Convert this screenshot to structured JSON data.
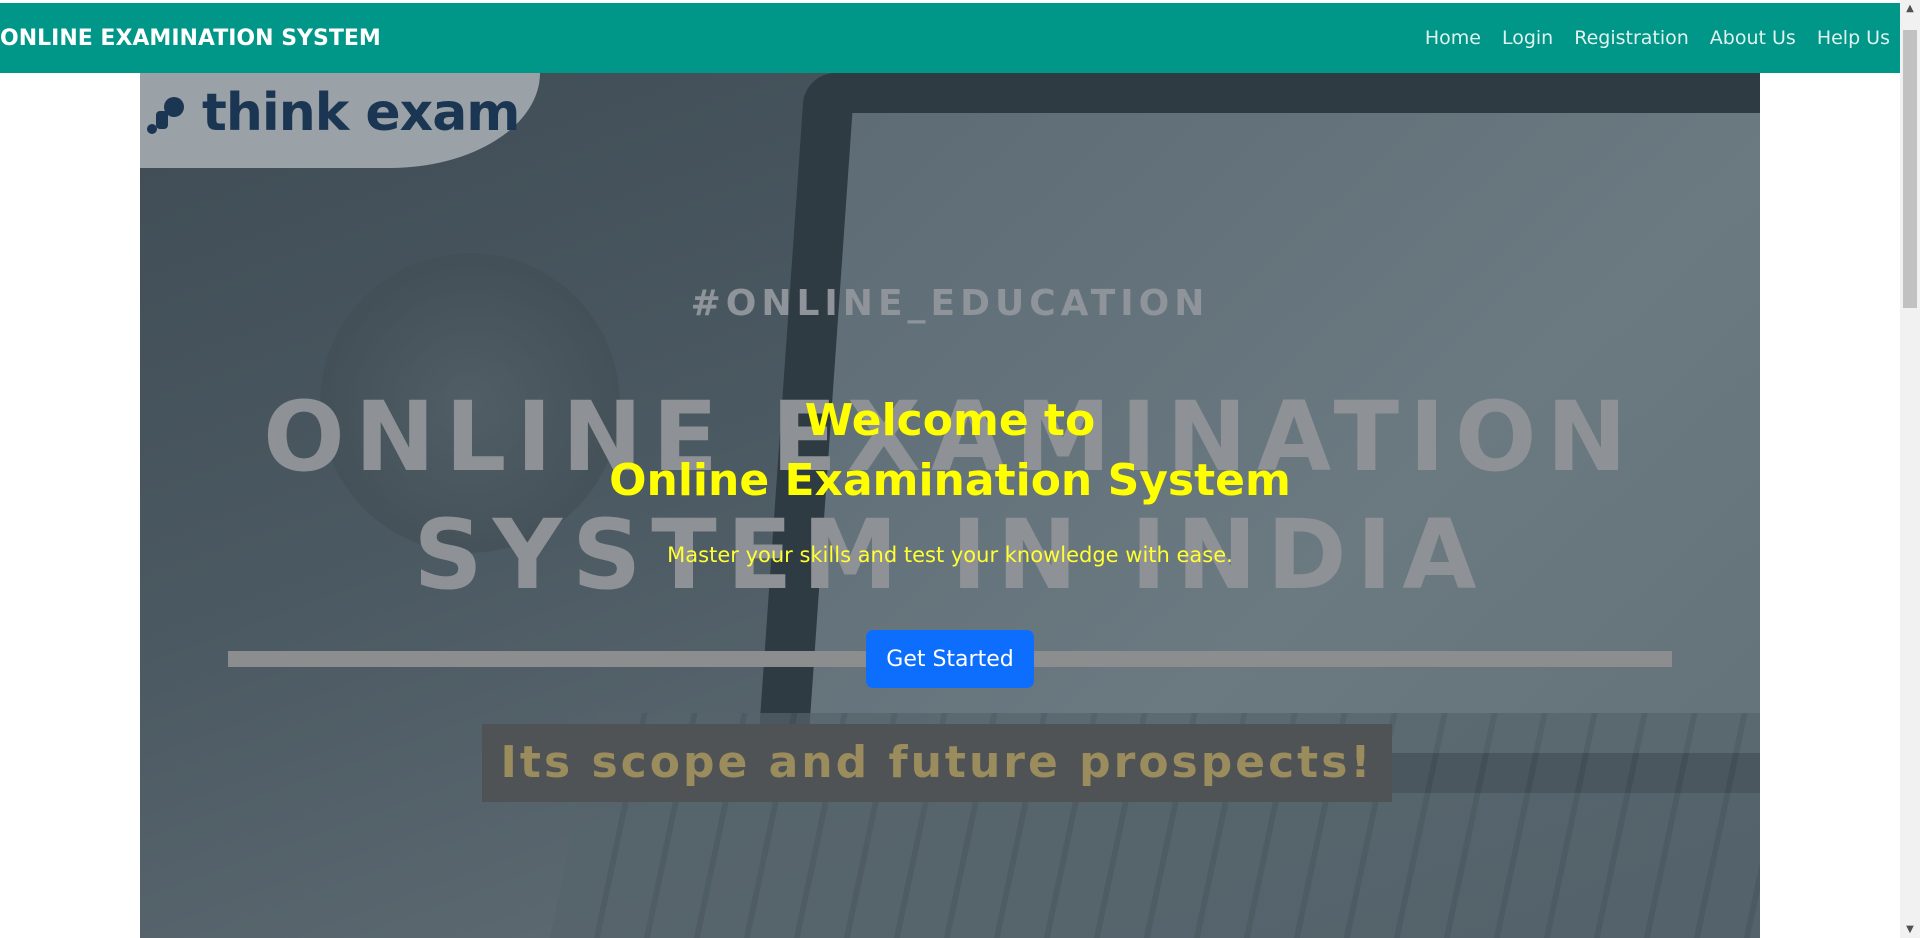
{
  "navbar": {
    "brand": "ONLINE EXAMINATION SYSTEM",
    "links": [
      "Home",
      "Login",
      "Registration",
      "About Us",
      "Help Us"
    ]
  },
  "hero": {
    "logo_text": "think exam",
    "bg_hashtag": "#ONLINE_EDUCATION",
    "bg_headline_line1": "ONLINE EXAMINATION",
    "bg_headline_line2": "SYSTEM IN INDIA",
    "bg_scope": "Its scope and future prospects!",
    "welcome_line1": "Welcome to",
    "welcome_line2": "Online Examination System",
    "subtitle": "Master your skills and test your knowledge with ease.",
    "cta_label": "Get Started"
  },
  "colors": {
    "navbar": "#009688",
    "headline": "#ffff00",
    "cta": "#0d6efd"
  },
  "icons": {
    "logo": "think-exam-logo-icon",
    "scroll_up": "scroll-up-arrow-icon",
    "scroll_down": "scroll-down-arrow-icon"
  }
}
